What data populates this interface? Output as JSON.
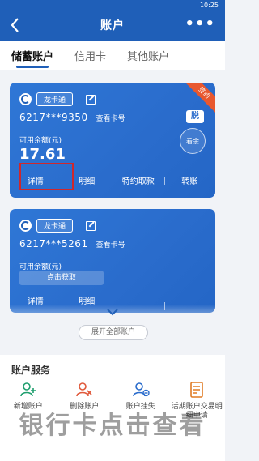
{
  "status_bar": {
    "time": "10:25"
  },
  "header": {
    "title": "账户",
    "more_label": "•••"
  },
  "tabs": [
    {
      "label": "储蓄账户",
      "active": true
    },
    {
      "label": "信用卡",
      "active": false
    },
    {
      "label": "其他账户",
      "active": false
    }
  ],
  "cards": [
    {
      "ribbon": "签约",
      "tag": "龙卡通",
      "number": "6217***9350",
      "view_card": "查看卡号",
      "badge": "脱",
      "balance_label": "可用余额(元)",
      "balance_value": "17.61",
      "eye_label": "看余",
      "actions": [
        "详情",
        "明细",
        "特约取款",
        "转账"
      ]
    },
    {
      "tag": "龙卡通",
      "number": "6217***5261",
      "view_card": "查看卡号",
      "balance_label": "可用余额(元)",
      "fetch_label": "点击获取",
      "actions": [
        "详情",
        "明细"
      ]
    }
  ],
  "expand_label": "展开全部账户",
  "services": {
    "title": "账户服务",
    "items": [
      {
        "label": "新增账户"
      },
      {
        "label": "删除账户"
      },
      {
        "label": "账户挂失"
      },
      {
        "label": "活期账户交易明细申请"
      }
    ]
  },
  "watermark": "银行卡点击查看",
  "colors": {
    "primary": "#1f5fb8",
    "card": "#2a6ccc",
    "ribbon": "#e8572e",
    "highlight": "#d0272c"
  }
}
